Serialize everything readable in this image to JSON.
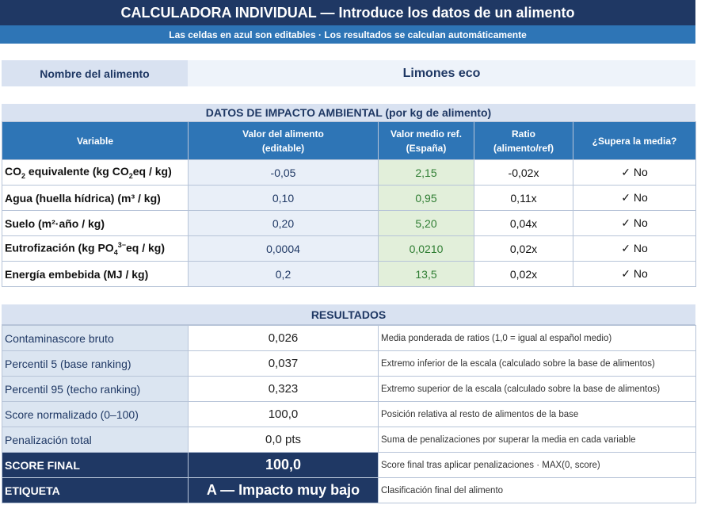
{
  "header": {
    "title": "CALCULADORA INDIVIDUAL — Introduce los datos de un alimento",
    "subtitle": "Las celdas en azul son editables · Los resultados se calculan automáticamente"
  },
  "food": {
    "label": "Nombre del alimento",
    "value": "Limones eco"
  },
  "impact": {
    "section_title": "DATOS DE IMPACTO AMBIENTAL (por kg de alimento)",
    "columns": [
      {
        "line1": "Variable",
        "line2": ""
      },
      {
        "line1": "Valor del alimento",
        "line2": "(editable)"
      },
      {
        "line1": "Valor medio ref.",
        "line2": "(España)"
      },
      {
        "line1": "Ratio",
        "line2": "(alimento/ref)"
      },
      {
        "line1": "¿Supera la media?",
        "line2": ""
      }
    ],
    "rows": [
      {
        "variable_pre": "CO",
        "variable_sub": "2",
        "variable_mid": " equivalente (kg CO",
        "variable_sub2": "2",
        "variable_post": "eq / kg)",
        "value": "-0,05",
        "ref": "2,15",
        "ratio": "-0,02x",
        "exceeds": "✓ No"
      },
      {
        "variable_pre": "Agua (huella hídrica) (m³ / kg)",
        "variable_sub": "",
        "variable_mid": "",
        "variable_sub2": "",
        "variable_post": "",
        "value": "0,10",
        "ref": "0,95",
        "ratio": "0,11x",
        "exceeds": "✓ No"
      },
      {
        "variable_pre": "Suelo (m²·año / kg)",
        "variable_sub": "",
        "variable_mid": "",
        "variable_sub2": "",
        "variable_post": "",
        "value": "0,20",
        "ref": "5,20",
        "ratio": "0,04x",
        "exceeds": "✓ No"
      },
      {
        "variable_pre": "Eutrofización (kg PO",
        "variable_sub": "4",
        "variable_mid": "",
        "variable_sub2": "",
        "variable_post": "eq / kg)",
        "variable_sup": "3−",
        "value": "0,0004",
        "ref": "0,0210",
        "ratio": "0,02x",
        "exceeds": "✓ No"
      },
      {
        "variable_pre": "Energía embebida (MJ / kg)",
        "variable_sub": "",
        "variable_mid": "",
        "variable_sub2": "",
        "variable_post": "",
        "value": "0,2",
        "ref": "13,5",
        "ratio": "0,02x",
        "exceeds": "✓ No"
      }
    ]
  },
  "results": {
    "section_title": "RESULTADOS",
    "rows": [
      {
        "label": "Contaminascore bruto",
        "value": "0,026",
        "desc": "Media ponderada de ratios (1,0 = igual al español medio)"
      },
      {
        "label": "Percentil 5 (base ranking)",
        "value": "0,037",
        "desc": "Extremo inferior de la escala (calculado sobre la base de alimentos)"
      },
      {
        "label": "Percentil 95 (techo ranking)",
        "value": "0,323",
        "desc": "Extremo superior de la escala (calculado sobre la base de alimentos)"
      },
      {
        "label": "Score normalizado (0–100)",
        "value": "100,0",
        "desc": "Posición relativa al resto de alimentos de la base"
      },
      {
        "label": "Penalización total",
        "value": "0,0 pts",
        "desc": "Suma de penalizaciones por superar la media en cada variable"
      },
      {
        "label": "SCORE FINAL",
        "value": "100,0",
        "desc": "Score final tras aplicar penalizaciones · MAX(0, score)"
      },
      {
        "label": "ETIQUETA",
        "value": "A — Impacto muy bajo",
        "desc": "Clasificación final del alimento"
      }
    ]
  }
}
